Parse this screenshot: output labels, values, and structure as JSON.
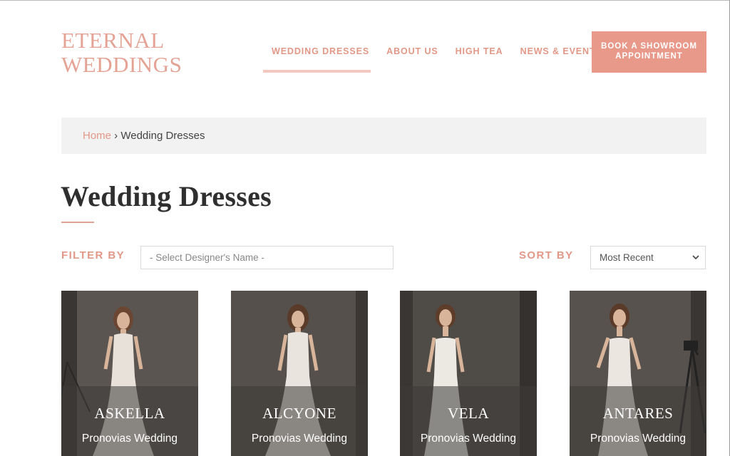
{
  "brand": {
    "line1": "ETERNAL",
    "line2": "WEDDINGS"
  },
  "nav": {
    "items": [
      {
        "label": "WEDDING DRESSES"
      },
      {
        "label": "ABOUT US"
      },
      {
        "label": "HIGH TEA"
      },
      {
        "label": "NEWS & EVENTS"
      }
    ],
    "active_index": 0
  },
  "cta": {
    "line1": "BOOK A SHOWROOM",
    "line2": "APPOINTMENT"
  },
  "breadcrumb": {
    "home": "Home",
    "separator": " › ",
    "current": "Wedding Dresses"
  },
  "page_title": "Wedding Dresses",
  "filter": {
    "label": "FILTER BY",
    "placeholder": "- Select Designer's Name -"
  },
  "sort": {
    "label": "SORT BY",
    "selected": "Most Recent"
  },
  "products": [
    {
      "name": "ASKELLA",
      "brand": "Pronovias Wedding"
    },
    {
      "name": "ALCYONE",
      "brand": "Pronovias Wedding"
    },
    {
      "name": "VELA",
      "brand": "Pronovias Wedding"
    },
    {
      "name": "ANTARES",
      "brand": "Pronovias Wedding"
    }
  ],
  "colors": {
    "accent": "#e29886",
    "cta_bg": "#e9998a",
    "breadcrumb_bg": "#f2f2f2",
    "card_bg": "#55504b"
  }
}
